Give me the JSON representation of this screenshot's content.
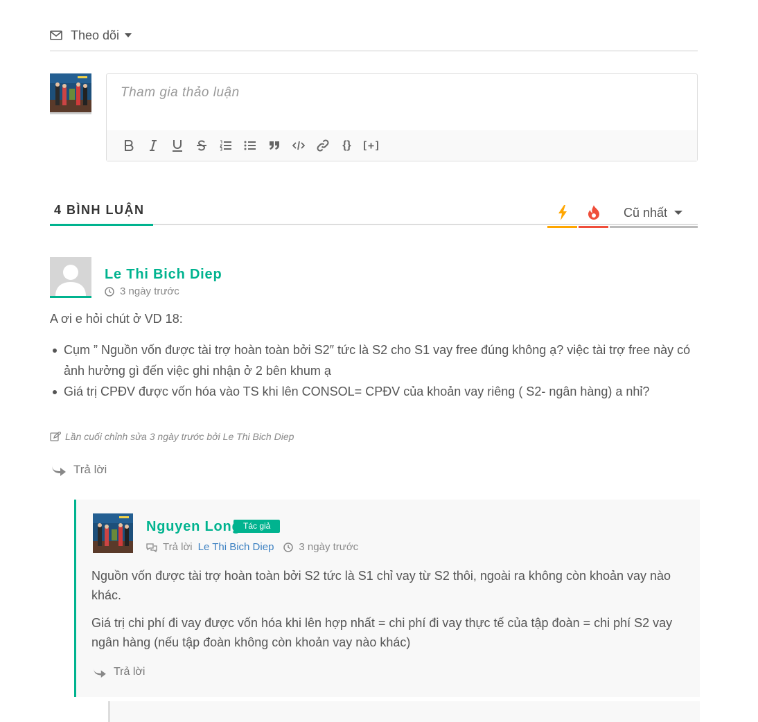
{
  "follow": {
    "label": "Theo dõi"
  },
  "composer": {
    "placeholder": "Tham gia thảo luận"
  },
  "toolbar": {
    "buttons": [
      "bold",
      "italic",
      "underline",
      "strikethrough",
      "ordered-list",
      "unordered-list",
      "blockquote",
      "code",
      "link",
      "source-code",
      "spoiler"
    ],
    "spoiler_label": "[+]",
    "source_label": "{}"
  },
  "comments_header": {
    "title": "4 BÌNH LUẬN",
    "sort_selected": "Cũ nhất",
    "colors": {
      "accent": "#00b38f",
      "newest": "#ffa600",
      "hottest": "#ef4e3a"
    }
  },
  "comment1": {
    "author": "Le Thi Bich Diep",
    "time": "3 ngày trước",
    "intro": "A ơi e hỏi chút ở VD 18:",
    "items": [
      "Cụm ” Nguồn vốn được tài trợ hoàn toàn bởi S2″ tức là S2 cho S1 vay free đúng không ạ? việc tài trợ free này có ảnh hưởng gì đến việc ghi nhận ở 2 bên khum ạ",
      "Giá trị CPĐV được vốn hóa vào TS khi lên CONSOL= CPĐV của khoản vay riêng ( S2- ngân hàng) a nhỉ?"
    ],
    "edited": "Lần cuối chỉnh sửa 3 ngày trước bởi Le Thi Bich Diep",
    "reply_label": "Trả lời"
  },
  "reply1": {
    "author": "Nguyen Long",
    "badge": "Tác giả",
    "reply_to_label": "Trả lời",
    "reply_to": "Le Thi Bich Diep",
    "time": "3 ngày trước",
    "p1": "Nguồn vốn được tài trợ hoàn toàn bởi S2 tức là S1 chỉ vay từ S2 thôi, ngoài ra không còn khoản vay nào khác.",
    "p2": "Giá trị chi phí đi vay được vốn hóa khi lên hợp nhất = chi phí đi vay thực tế của tập đoàn = chi phí S2 vay ngân hàng (nếu tập đoàn không còn khoản vay nào khác)",
    "reply_label": "Trả lời"
  }
}
